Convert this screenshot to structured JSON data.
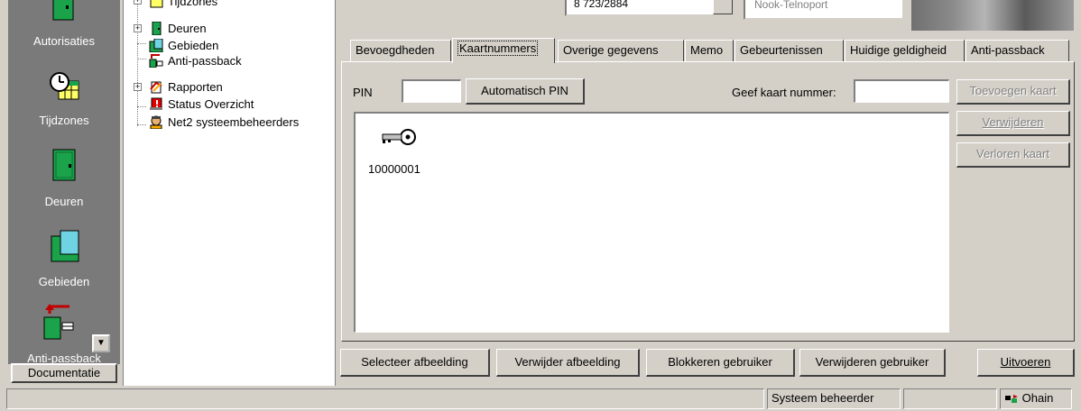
{
  "leftbar": {
    "items": [
      {
        "label": "Autorisaties",
        "icon": "authorization-icon"
      },
      {
        "label": "Tijdzones",
        "icon": "clock-calendar-icon"
      },
      {
        "label": "Deuren",
        "icon": "door-icon"
      },
      {
        "label": "Gebieden",
        "icon": "area-icon"
      },
      {
        "label": "Anti-passback",
        "icon": "anti-passback-icon"
      }
    ],
    "documentation_button": "Documentatie"
  },
  "tree": {
    "items": [
      {
        "label": "Tijdzones",
        "icon": "clock-calendar-icon",
        "expandable": true
      },
      {
        "label": "Deuren",
        "icon": "door-icon",
        "expandable": true
      },
      {
        "label": "Gebieden",
        "icon": "area-icon",
        "expandable": false
      },
      {
        "label": "Anti-passback",
        "icon": "anti-passback-icon",
        "expandable": false
      },
      {
        "label": "Rapporten",
        "icon": "reports-icon",
        "expandable": true
      },
      {
        "label": "Status Overzicht",
        "icon": "status-icon",
        "expandable": false
      },
      {
        "label": "Net2 systeembeheerders",
        "icon": "administrator-icon",
        "expandable": false
      }
    ]
  },
  "top_fields": {
    "field1": "8 723/2884",
    "field2": "Nook-Telnoport"
  },
  "tabs": [
    {
      "label": "Bevoegdheden",
      "active": false
    },
    {
      "label": "Kaartnummers",
      "active": true
    },
    {
      "label": "Overige gegevens",
      "active": false
    },
    {
      "label": "Memo",
      "active": false
    },
    {
      "label": "Gebeurtenissen",
      "active": false
    },
    {
      "label": "Huidige geldigheid",
      "active": false
    },
    {
      "label": "Anti-passback",
      "active": false
    }
  ],
  "card_tab": {
    "pin_label": "PIN",
    "pin_value": "",
    "auto_pin_button": "Automatisch PIN",
    "card_number_label": "Geef kaart nummer:",
    "card_number_value": "",
    "add_card_button": "Toevoegen kaart",
    "remove_button": "Verwijderen",
    "lost_card_button": "Verloren kaart",
    "cards": [
      {
        "number": "10000001",
        "icon": "key-icon"
      }
    ]
  },
  "bottom_buttons": {
    "select_image": "Selecteer afbeelding",
    "remove_image": "Verwijder afbeelding",
    "block_user": "Blokkeren gebruiker",
    "delete_user": "Verwijderen gebruiker",
    "execute": "Uitvoeren"
  },
  "statusbar": {
    "user_role": "Systeem beheerder",
    "empty_pane": "",
    "connection": "Ohain",
    "connection_icon": "network-icon"
  },
  "colors": {
    "face": "#d4d0c8",
    "leftbar_bg": "#7a7a7a",
    "door_green": "#1aa34a",
    "area_cyan": "#6fd3e3"
  }
}
